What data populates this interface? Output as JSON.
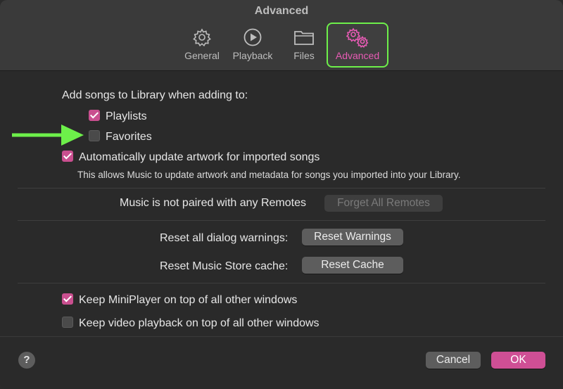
{
  "window": {
    "title": "Advanced"
  },
  "tabs": [
    {
      "label": "General",
      "icon": "gear-icon"
    },
    {
      "label": "Playback",
      "icon": "play-circle-icon"
    },
    {
      "label": "Files",
      "icon": "folder-icon"
    },
    {
      "label": "Advanced",
      "icon": "gears-icon",
      "active": true
    }
  ],
  "library": {
    "heading": "Add songs to Library when adding to:",
    "playlists": {
      "label": "Playlists",
      "checked": true
    },
    "favorites": {
      "label": "Favorites",
      "checked": false
    }
  },
  "artwork": {
    "label": "Automatically update artwork for imported songs",
    "checked": true,
    "description": "This allows Music to update artwork and metadata for songs you imported into your Library."
  },
  "remotes": {
    "status": "Music is not paired with any Remotes",
    "button_label": "Forget All Remotes"
  },
  "reset": {
    "warnings_label": "Reset all dialog warnings:",
    "warnings_button": "Reset Warnings",
    "cache_label": "Reset Music Store cache:",
    "cache_button": "Reset Cache"
  },
  "miniplayer": {
    "label": "Keep MiniPlayer on top of all other windows",
    "checked": true
  },
  "video": {
    "label": "Keep video playback on top of all other windows",
    "checked": false
  },
  "footer": {
    "help_label": "?",
    "cancel_label": "Cancel",
    "ok_label": "OK"
  },
  "colors": {
    "accent": "#cf4f95",
    "highlight": "#6df04a"
  }
}
